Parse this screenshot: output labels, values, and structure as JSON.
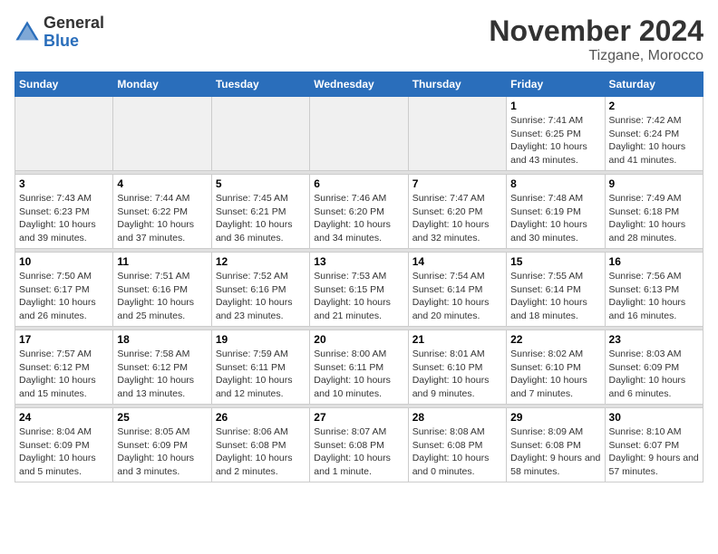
{
  "logo": {
    "general": "General",
    "blue": "Blue"
  },
  "header": {
    "month_title": "November 2024",
    "location": "Tizgane, Morocco"
  },
  "weekdays": [
    "Sunday",
    "Monday",
    "Tuesday",
    "Wednesday",
    "Thursday",
    "Friday",
    "Saturday"
  ],
  "weeks": [
    [
      {
        "day": "",
        "empty": true
      },
      {
        "day": "",
        "empty": true
      },
      {
        "day": "",
        "empty": true
      },
      {
        "day": "",
        "empty": true
      },
      {
        "day": "",
        "empty": true
      },
      {
        "day": "1",
        "sunrise": "Sunrise: 7:41 AM",
        "sunset": "Sunset: 6:25 PM",
        "daylight": "Daylight: 10 hours and 43 minutes."
      },
      {
        "day": "2",
        "sunrise": "Sunrise: 7:42 AM",
        "sunset": "Sunset: 6:24 PM",
        "daylight": "Daylight: 10 hours and 41 minutes."
      }
    ],
    [
      {
        "day": "3",
        "sunrise": "Sunrise: 7:43 AM",
        "sunset": "Sunset: 6:23 PM",
        "daylight": "Daylight: 10 hours and 39 minutes."
      },
      {
        "day": "4",
        "sunrise": "Sunrise: 7:44 AM",
        "sunset": "Sunset: 6:22 PM",
        "daylight": "Daylight: 10 hours and 37 minutes."
      },
      {
        "day": "5",
        "sunrise": "Sunrise: 7:45 AM",
        "sunset": "Sunset: 6:21 PM",
        "daylight": "Daylight: 10 hours and 36 minutes."
      },
      {
        "day": "6",
        "sunrise": "Sunrise: 7:46 AM",
        "sunset": "Sunset: 6:20 PM",
        "daylight": "Daylight: 10 hours and 34 minutes."
      },
      {
        "day": "7",
        "sunrise": "Sunrise: 7:47 AM",
        "sunset": "Sunset: 6:20 PM",
        "daylight": "Daylight: 10 hours and 32 minutes."
      },
      {
        "day": "8",
        "sunrise": "Sunrise: 7:48 AM",
        "sunset": "Sunset: 6:19 PM",
        "daylight": "Daylight: 10 hours and 30 minutes."
      },
      {
        "day": "9",
        "sunrise": "Sunrise: 7:49 AM",
        "sunset": "Sunset: 6:18 PM",
        "daylight": "Daylight: 10 hours and 28 minutes."
      }
    ],
    [
      {
        "day": "10",
        "sunrise": "Sunrise: 7:50 AM",
        "sunset": "Sunset: 6:17 PM",
        "daylight": "Daylight: 10 hours and 26 minutes."
      },
      {
        "day": "11",
        "sunrise": "Sunrise: 7:51 AM",
        "sunset": "Sunset: 6:16 PM",
        "daylight": "Daylight: 10 hours and 25 minutes."
      },
      {
        "day": "12",
        "sunrise": "Sunrise: 7:52 AM",
        "sunset": "Sunset: 6:16 PM",
        "daylight": "Daylight: 10 hours and 23 minutes."
      },
      {
        "day": "13",
        "sunrise": "Sunrise: 7:53 AM",
        "sunset": "Sunset: 6:15 PM",
        "daylight": "Daylight: 10 hours and 21 minutes."
      },
      {
        "day": "14",
        "sunrise": "Sunrise: 7:54 AM",
        "sunset": "Sunset: 6:14 PM",
        "daylight": "Daylight: 10 hours and 20 minutes."
      },
      {
        "day": "15",
        "sunrise": "Sunrise: 7:55 AM",
        "sunset": "Sunset: 6:14 PM",
        "daylight": "Daylight: 10 hours and 18 minutes."
      },
      {
        "day": "16",
        "sunrise": "Sunrise: 7:56 AM",
        "sunset": "Sunset: 6:13 PM",
        "daylight": "Daylight: 10 hours and 16 minutes."
      }
    ],
    [
      {
        "day": "17",
        "sunrise": "Sunrise: 7:57 AM",
        "sunset": "Sunset: 6:12 PM",
        "daylight": "Daylight: 10 hours and 15 minutes."
      },
      {
        "day": "18",
        "sunrise": "Sunrise: 7:58 AM",
        "sunset": "Sunset: 6:12 PM",
        "daylight": "Daylight: 10 hours and 13 minutes."
      },
      {
        "day": "19",
        "sunrise": "Sunrise: 7:59 AM",
        "sunset": "Sunset: 6:11 PM",
        "daylight": "Daylight: 10 hours and 12 minutes."
      },
      {
        "day": "20",
        "sunrise": "Sunrise: 8:00 AM",
        "sunset": "Sunset: 6:11 PM",
        "daylight": "Daylight: 10 hours and 10 minutes."
      },
      {
        "day": "21",
        "sunrise": "Sunrise: 8:01 AM",
        "sunset": "Sunset: 6:10 PM",
        "daylight": "Daylight: 10 hours and 9 minutes."
      },
      {
        "day": "22",
        "sunrise": "Sunrise: 8:02 AM",
        "sunset": "Sunset: 6:10 PM",
        "daylight": "Daylight: 10 hours and 7 minutes."
      },
      {
        "day": "23",
        "sunrise": "Sunrise: 8:03 AM",
        "sunset": "Sunset: 6:09 PM",
        "daylight": "Daylight: 10 hours and 6 minutes."
      }
    ],
    [
      {
        "day": "24",
        "sunrise": "Sunrise: 8:04 AM",
        "sunset": "Sunset: 6:09 PM",
        "daylight": "Daylight: 10 hours and 5 minutes."
      },
      {
        "day": "25",
        "sunrise": "Sunrise: 8:05 AM",
        "sunset": "Sunset: 6:09 PM",
        "daylight": "Daylight: 10 hours and 3 minutes."
      },
      {
        "day": "26",
        "sunrise": "Sunrise: 8:06 AM",
        "sunset": "Sunset: 6:08 PM",
        "daylight": "Daylight: 10 hours and 2 minutes."
      },
      {
        "day": "27",
        "sunrise": "Sunrise: 8:07 AM",
        "sunset": "Sunset: 6:08 PM",
        "daylight": "Daylight: 10 hours and 1 minute."
      },
      {
        "day": "28",
        "sunrise": "Sunrise: 8:08 AM",
        "sunset": "Sunset: 6:08 PM",
        "daylight": "Daylight: 10 hours and 0 minutes."
      },
      {
        "day": "29",
        "sunrise": "Sunrise: 8:09 AM",
        "sunset": "Sunset: 6:08 PM",
        "daylight": "Daylight: 9 hours and 58 minutes."
      },
      {
        "day": "30",
        "sunrise": "Sunrise: 8:10 AM",
        "sunset": "Sunset: 6:07 PM",
        "daylight": "Daylight: 9 hours and 57 minutes."
      }
    ]
  ]
}
